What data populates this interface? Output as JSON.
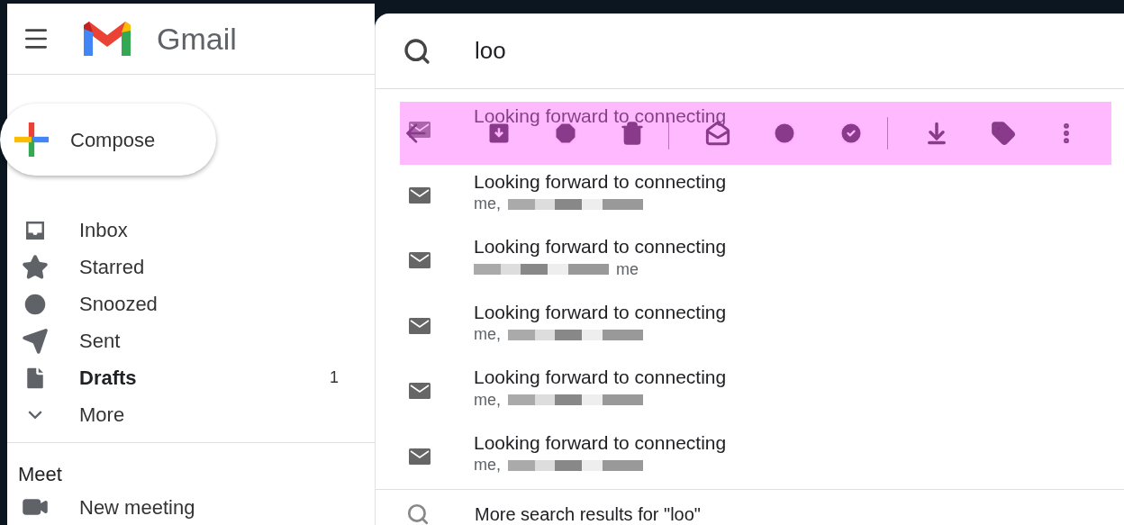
{
  "app": {
    "name": "Gmail"
  },
  "compose": {
    "label": "Compose"
  },
  "sidebar": {
    "items": [
      {
        "label": "Inbox",
        "unread": false
      },
      {
        "label": "Starred",
        "unread": false
      },
      {
        "label": "Snoozed",
        "unread": false
      },
      {
        "label": "Sent",
        "unread": false
      },
      {
        "label": "Drafts",
        "unread": true,
        "count": "1"
      },
      {
        "label": "More",
        "unread": false
      }
    ]
  },
  "meet": {
    "title": "Meet",
    "items": [
      {
        "label": "New meeting"
      }
    ]
  },
  "search": {
    "value": "loo"
  },
  "results": [
    {
      "subject": "Looking forward to connecting"
    },
    {
      "subject": "Looking forward to connecting",
      "senders": [
        {
          "kind": "text",
          "text": "me,"
        },
        {
          "kind": "redacted"
        }
      ]
    },
    {
      "subject": "Looking forward to connecting",
      "senders": [
        {
          "kind": "redacted"
        },
        {
          "kind": "text",
          "text": "me"
        }
      ]
    },
    {
      "subject": "Looking forward to connecting",
      "senders": [
        {
          "kind": "text",
          "text": "me,"
        },
        {
          "kind": "redacted"
        }
      ]
    },
    {
      "subject": "Looking forward to connecting",
      "senders": [
        {
          "kind": "text",
          "text": "me,"
        },
        {
          "kind": "redacted"
        }
      ]
    },
    {
      "subject": "Looking forward to connecting",
      "senders": [
        {
          "kind": "text",
          "text": "me,"
        },
        {
          "kind": "redacted"
        }
      ]
    }
  ],
  "more_results": {
    "label": "More search results for \"loo\""
  }
}
